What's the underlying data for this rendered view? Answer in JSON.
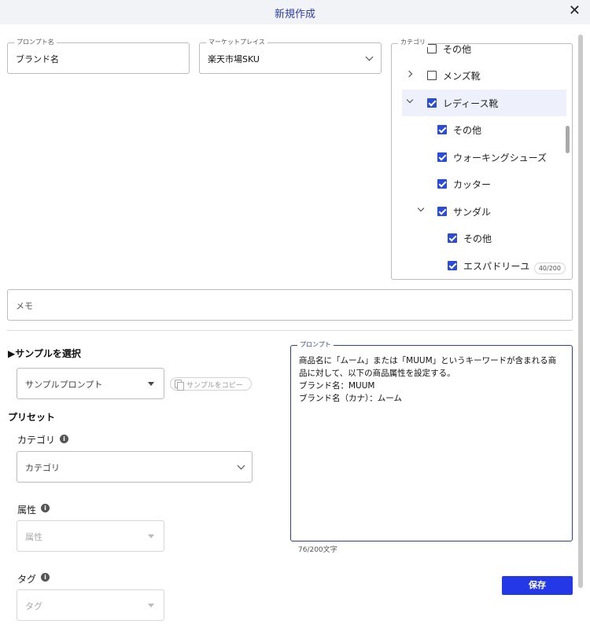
{
  "dialog": {
    "title": "新規作成"
  },
  "prompt_name": {
    "label": "プロンプト名",
    "value": "ブランド名"
  },
  "marketplace": {
    "label": "マーケットプレイス",
    "value": "楽天市場SKU"
  },
  "category_tree": {
    "label": "カテゴリ",
    "items": [
      {
        "label": "その他",
        "checked": false
      },
      {
        "label": "メンズ靴",
        "checked": false,
        "expand": "collapsed"
      },
      {
        "label": "レディース靴",
        "checked": true,
        "expand": "expanded",
        "selected": true
      },
      {
        "label": "その他",
        "checked": true
      },
      {
        "label": "ウォーキングシューズ",
        "checked": true
      },
      {
        "label": "カッター",
        "checked": true
      },
      {
        "label": "サンダル",
        "checked": true,
        "expand": "expanded"
      },
      {
        "label": "その他",
        "checked": true
      },
      {
        "label": "エスパドリーユ",
        "checked": true
      }
    ],
    "counter": "40/200"
  },
  "memo": {
    "placeholder": "メモ"
  },
  "sample": {
    "title": "▶サンプルを選択",
    "select_placeholder": "サンプルプロンプト",
    "copy_label": "サンプルをコピー"
  },
  "preset": {
    "title": "プリセット",
    "category": {
      "label": "カテゴリ",
      "placeholder": "カテゴリ"
    },
    "attribute": {
      "label": "属性",
      "placeholder": "属性"
    },
    "tag": {
      "label": "タグ",
      "placeholder": "タグ"
    }
  },
  "prompt": {
    "label": "プロンプト",
    "text": "商品名に「ムーム」または「MUUM」というキーワードが含まれる商品に対して、以下の商品属性を設定する。\nブランド名：MUUM\nブランド名（カナ）：ムーム",
    "char_count": "76/200文字"
  },
  "save_button": "保存",
  "colors": {
    "accent": "#2d4bd9",
    "primary_button": "#2438e8",
    "title": "#2b3fa8"
  }
}
